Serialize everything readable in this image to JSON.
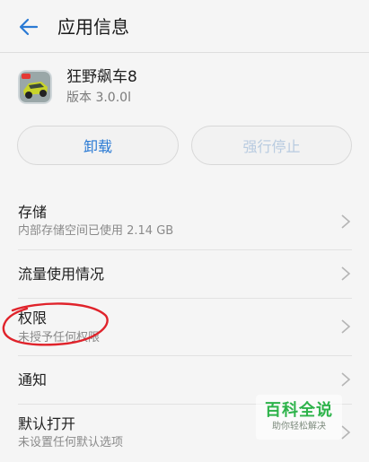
{
  "header": {
    "title": "应用信息",
    "back_icon": "arrow-left-icon",
    "accent": "#2a7ad4"
  },
  "app": {
    "name": "狂野飙车8",
    "version": "版本 3.0.0l",
    "icon": "racing-car-app-icon"
  },
  "buttons": {
    "uninstall": "卸载",
    "force_stop": "强行停止"
  },
  "settings": {
    "storage": {
      "title": "存储",
      "sub": "内部存储空间已使用 2.14 GB"
    },
    "data_usage": {
      "title": "流量使用情况"
    },
    "permissions": {
      "title": "权限",
      "sub": "未授予任何权限"
    },
    "notifications": {
      "title": "通知"
    },
    "default_open": {
      "title": "默认打开",
      "sub": "未设置任何默认选项"
    }
  },
  "annotation": {
    "shape": "red-circle",
    "color": "#e0232b"
  },
  "watermark": {
    "main": "百科全说",
    "sub": "助你轻松解决"
  }
}
